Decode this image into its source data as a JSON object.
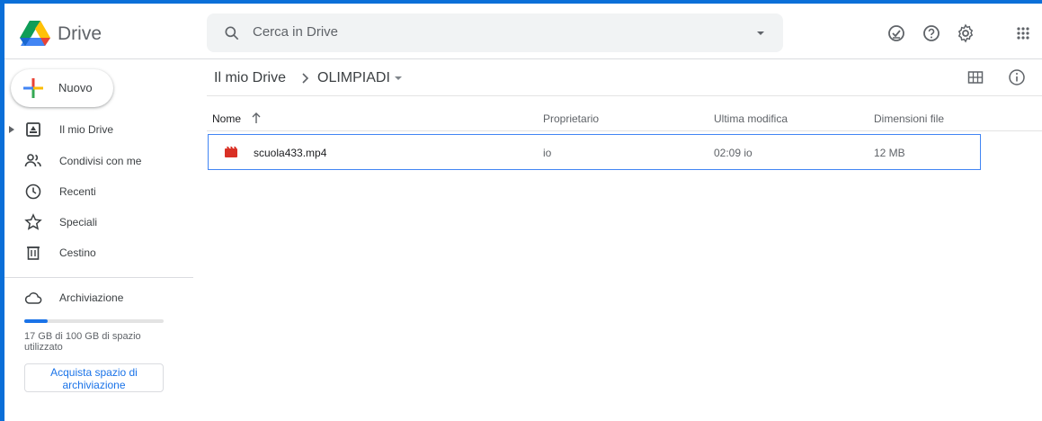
{
  "app": {
    "name": "Drive"
  },
  "search": {
    "placeholder": "Cerca in Drive"
  },
  "sidebar": {
    "new_label": "Nuovo",
    "items": [
      {
        "label": "Il mio Drive"
      },
      {
        "label": "Condivisi con me"
      },
      {
        "label": "Recenti"
      },
      {
        "label": "Speciali"
      },
      {
        "label": "Cestino"
      },
      {
        "label": "Archiviazione"
      }
    ],
    "storage": {
      "text": "17 GB di 100 GB di spazio utilizzato",
      "used_fraction": 0.17
    },
    "buy_label": "Acquista spazio di archiviazione"
  },
  "breadcrumb": {
    "root": "Il mio Drive",
    "current": "OLIMPIADI"
  },
  "columns": {
    "name": "Nome",
    "owner": "Proprietario",
    "modified": "Ultima modifica",
    "size": "Dimensioni file"
  },
  "files": [
    {
      "name": "scuola433.mp4",
      "owner": "io",
      "modified": "02:09 io",
      "size": "12 MB"
    }
  ],
  "colors": {
    "accent": "#1a73e8",
    "frame": "#0a6fd8",
    "video_icon": "#d93025"
  }
}
